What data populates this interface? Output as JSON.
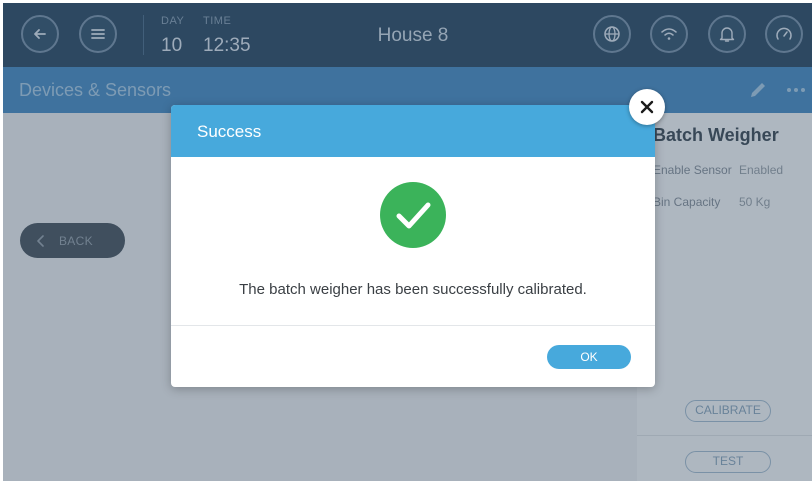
{
  "topbar": {
    "day_caption": "DAY",
    "day_value": "10",
    "time_caption": "TIME",
    "time_value": "12:35",
    "house_title": "House 8",
    "icons": [
      "back-arrow-icon",
      "menu-icon",
      "globe-icon",
      "wifi-icon",
      "bell-icon",
      "gauge-icon"
    ]
  },
  "page": {
    "title": "Devices & Sensors",
    "back_label": "BACK"
  },
  "right_panel": {
    "title": "Batch Weigher",
    "rows": [
      {
        "label": "Enable Sensor",
        "value": "Enabled"
      },
      {
        "label": "Bin Capacity",
        "value": "50 Kg"
      }
    ],
    "calibrate_label": "CALIBRATE",
    "test_label": "TEST"
  },
  "modal": {
    "title": "Success",
    "message": "The batch weigher has been successfully calibrated.",
    "ok_label": "OK",
    "status": "success"
  },
  "colors": {
    "topbar_bg": "#1d3e5a",
    "header_bg": "#3b82bb",
    "modal_header": "#47a9dc",
    "success_green": "#3bb35a"
  }
}
